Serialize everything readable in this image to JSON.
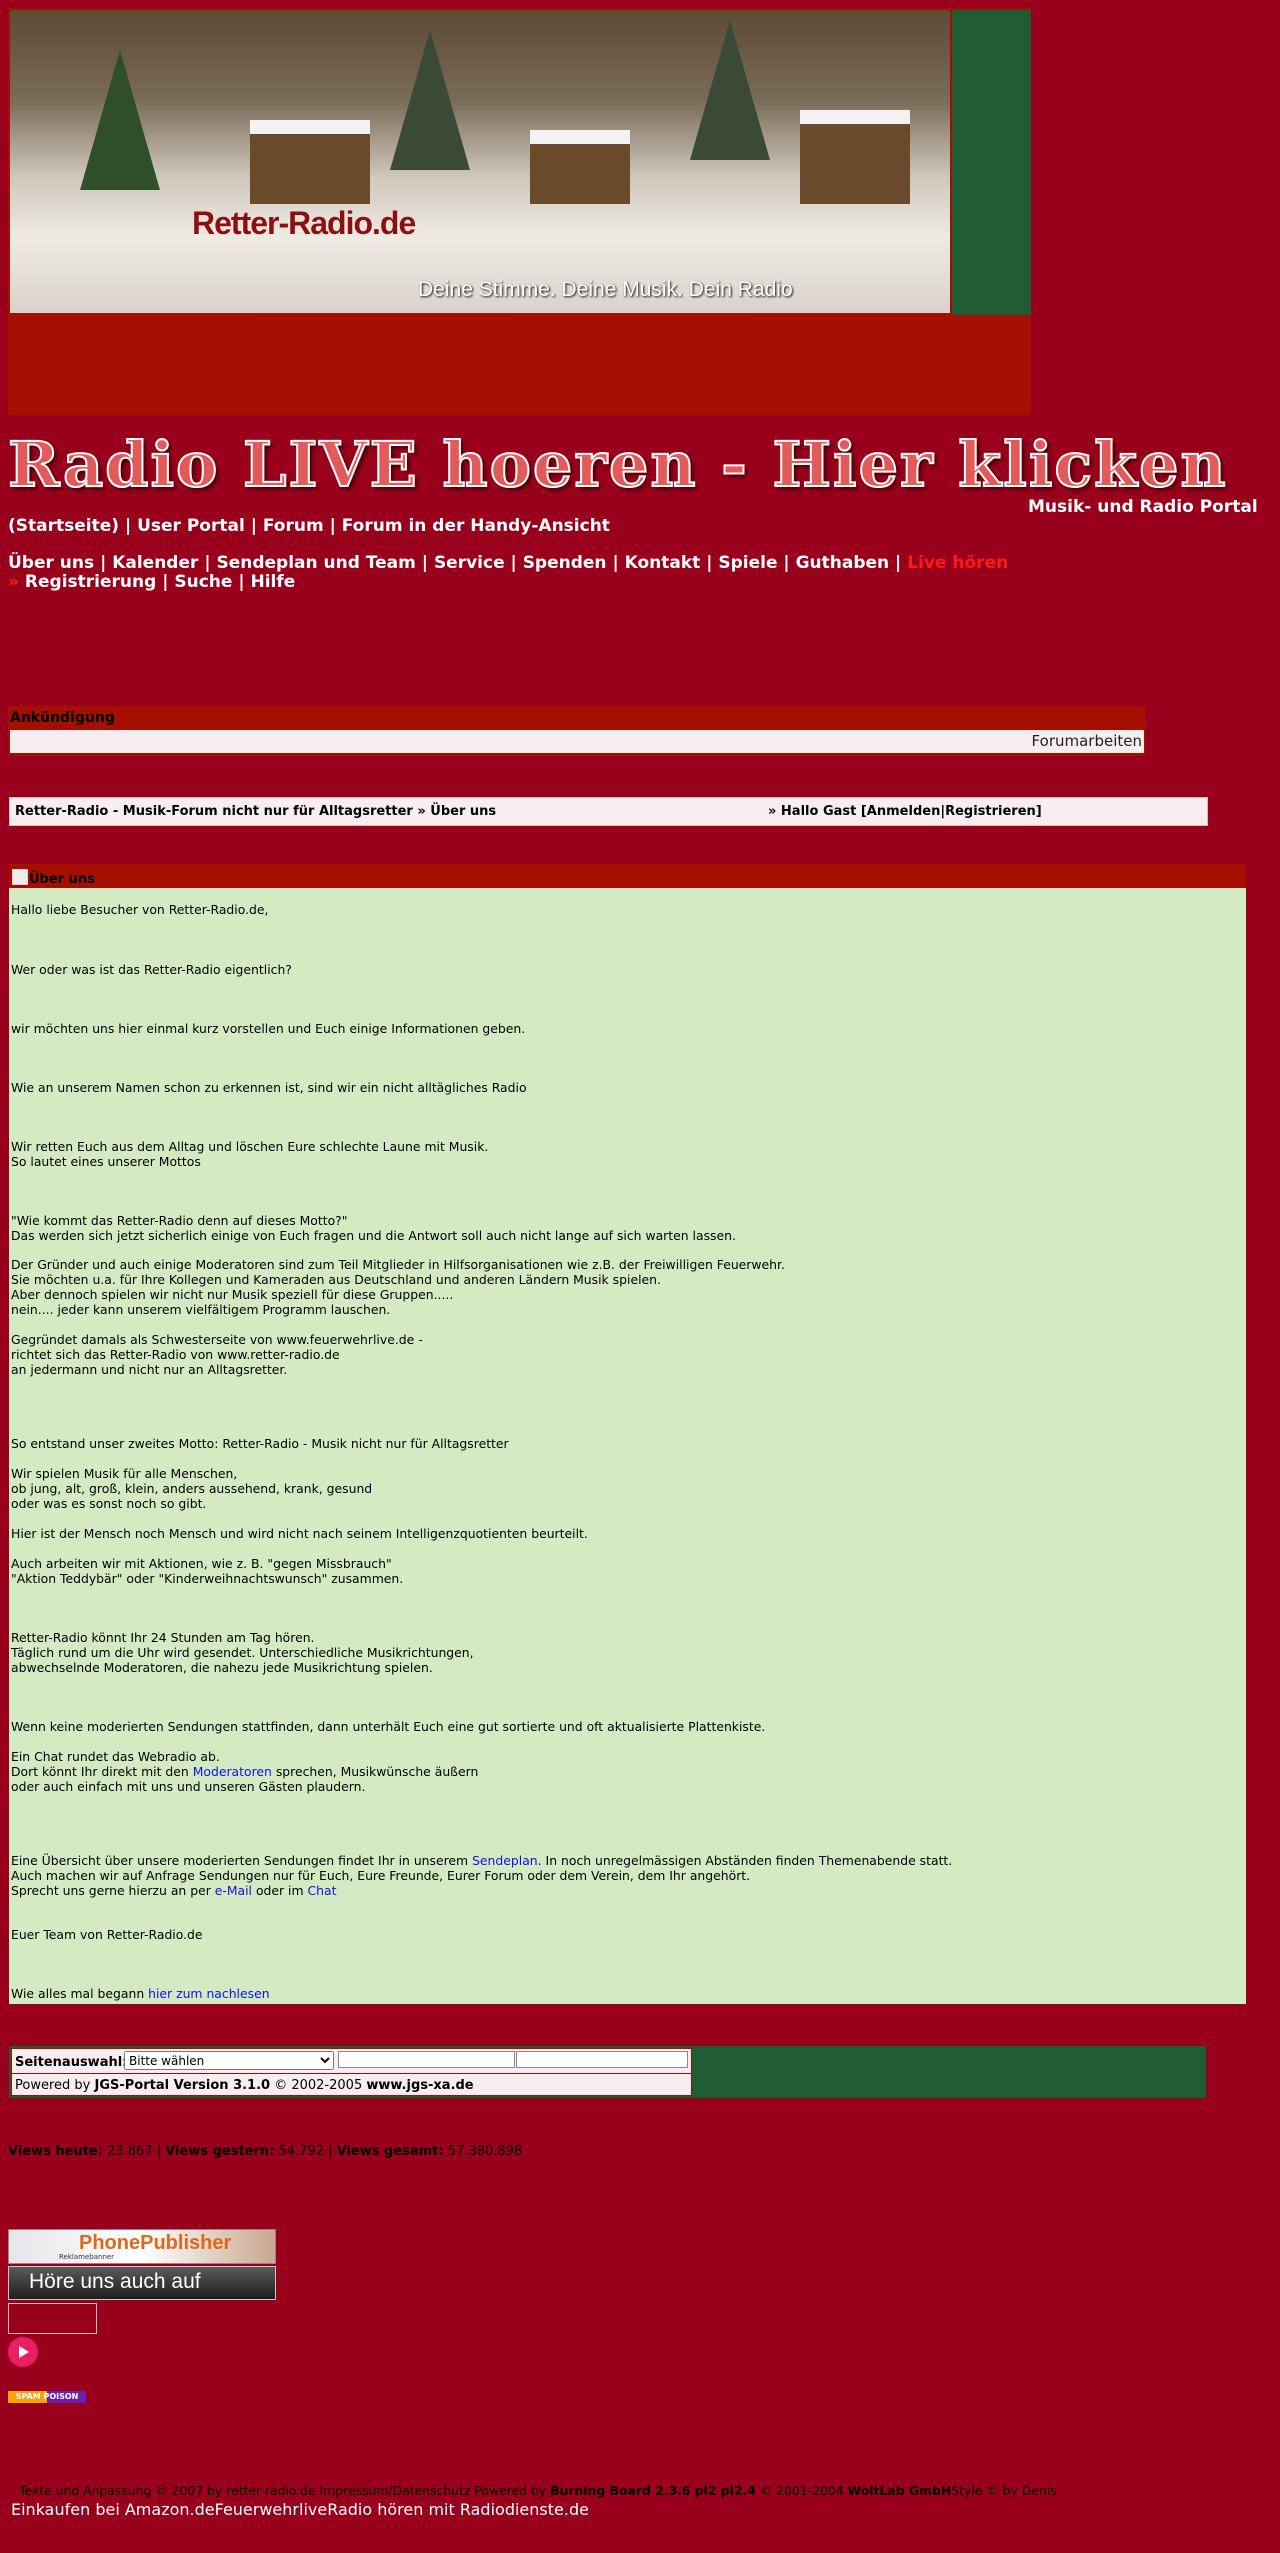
{
  "banner": {
    "brand": "Retter-Radio.de",
    "slogan": "Deine Stimme. Deine Musik. Dein Radio"
  },
  "live_banner": "Radio LIVE hoeren - Hier klicken",
  "portal_title": "Musik- und Radio Portal",
  "nav": {
    "row1": [
      "(Startseite)",
      "User Portal",
      "Forum",
      "Forum in der Handy-Ansicht"
    ],
    "row2": [
      "Über uns",
      "Kalender",
      "Sendeplan und Team",
      "Service",
      "Spenden",
      "Kontakt",
      "Spiele",
      "Guthaben"
    ],
    "live": "Live hören",
    "raquo": "»",
    "row3": [
      "Registrierung",
      "Suche",
      "Hilfe"
    ]
  },
  "announcement": {
    "title": "Ankündigung",
    "text": "Forumarbeiten"
  },
  "breadcrumb": {
    "path": "Retter-Radio - Musik-Forum nicht nur für Alltagsretter » Über uns",
    "user": "» Hallo Gast [Anmelden|Registrieren]"
  },
  "content": {
    "title": "Über uns",
    "p1": "Hallo liebe Besucher von Retter-Radio.de,",
    "p2": "Wer oder was ist das Retter-Radio eigentlich?",
    "p3": "wir möchten uns hier einmal kurz vorstellen und Euch einige Informationen geben.",
    "p4": "Wie an unserem Namen schon zu erkennen ist, sind wir ein nicht alltägliches Radio",
    "p5": "Wir retten Euch aus dem Alltag und löschen Eure schlechte Laune mit Musik.\nSo lautet eines unserer Mottos",
    "p6": "\"Wie kommt das Retter-Radio denn auf dieses Motto?\"\nDas werden sich jetzt sicherlich einige von Euch fragen und die Antwort soll auch nicht lange auf sich warten lassen.",
    "p7": "Der Gründer und auch einige Moderatoren sind zum Teil Mitglieder in Hilfsorganisationen wie z.B. der Freiwilligen Feuerwehr.\nSie möchten u.a. für Ihre Kollegen und Kameraden aus Deutschland und anderen Ländern Musik spielen.\nAber dennoch spielen wir nicht nur Musik speziell für diese Gruppen.....\nnein.... jeder kann unserem vielfältigem Programm lauschen.",
    "p8": "Gegründet damals als Schwesterseite von www.feuerwehrlive.de -\nrichtet sich das Retter-Radio von www.retter-radio.de\nan jedermann und nicht nur an Alltagsretter.",
    "p9": "So entstand unser zweites Motto: Retter-Radio - Musik nicht nur für Alltagsretter",
    "p10": "Wir spielen Musik für alle Menschen,\nob jung, alt, groß, klein, anders aussehend, krank, gesund\noder was es sonst noch so gibt.",
    "p11": "Hier ist der Mensch noch Mensch und wird nicht nach seinem Intelligenzquotienten beurteilt.",
    "p12": "Auch arbeiten wir mit Aktionen, wie z. B. \"gegen Missbrauch\"\n\"Aktion Teddybär\" oder \"Kinderweihnachtswunsch\" zusammen.",
    "p13": "Retter-Radio könnt Ihr 24 Stunden am Tag hören.\nTäglich rund um die Uhr wird gesendet. Unterschiedliche Musikrichtungen,\nabwechselnde Moderatoren, die nahezu jede Musikrichtung spielen.",
    "p14": "Wenn keine moderierten Sendungen stattfinden, dann unterhält Euch eine gut sortierte und oft aktualisierte Plattenkiste.",
    "p15a": "Ein Chat rundet das Webradio ab.\nDort könnt Ihr direkt mit den ",
    "p15_link": "Moderatoren",
    "p15b": " sprechen, Musikwünsche äußern\noder auch einfach mit uns und unseren Gästen plaudern.",
    "p16a": "Eine Übersicht über unsere moderierten Sendungen findet Ihr in unserem ",
    "p16_link": "Sendeplan",
    "p16b": ". In noch unregelmässigen Abständen finden Themenabende statt.\nAuch machen wir auf Anfrage Sendungen nur für Euch, Eure Freunde, Eurer Forum oder dem Verein, dem Ihr angehört.\nSprecht uns gerne hierzu an per ",
    "p16_link2": "e-Mail",
    "p16c": " oder im ",
    "p16_link3": "Chat",
    "p17": "Euer Team von Retter-Radio.de",
    "p18a": "Wie alles mal begann ",
    "p18_link": "hier zum nachlesen"
  },
  "selector": {
    "label": "Seitenauswahl:",
    "selected": "Bitte wählen",
    "powered_prefix": "Powered by ",
    "powered_name": "JGS-Portal Version 3.1.0",
    "powered_mid": " © 2002-2005 ",
    "powered_site": "www.jgs-xa.de"
  },
  "views": {
    "today_label": "Views heute:",
    "today": "23.867",
    "yesterday_label": "Views gestern:",
    "yesterday": "54.792",
    "total_label": "Views gesamt:",
    "total": "57.380.898"
  },
  "badges": {
    "phone": "PhonePublisher",
    "phone_sub": "Reklamebanner",
    "hoere": "Höre uns auch auf",
    "spam": "SPAM POISON"
  },
  "footer": {
    "line1_a": "Texte und Anpassung © 2007 by retter-radio.de   Impressum/Datenschutz   Powered by ",
    "line1_b": "Burning Board 2.3.6 pl2 pl2.4",
    "line1_c": " © 2001-2004 ",
    "line1_d": "WoltLab GmbH",
    "line1_e": "Style © by Denis",
    "line2": "Einkaufen bei Amazon.deFeuerwehrliveRadio hören mit Radiodienste.de"
  },
  "colors": {
    "page_bg": "#98001c",
    "header_red": "#a50f00",
    "header_green": "#1e5c33",
    "content_bg": "#d3eac3",
    "link_blue": "#1212e6",
    "live_red": "#ff1a1a"
  }
}
